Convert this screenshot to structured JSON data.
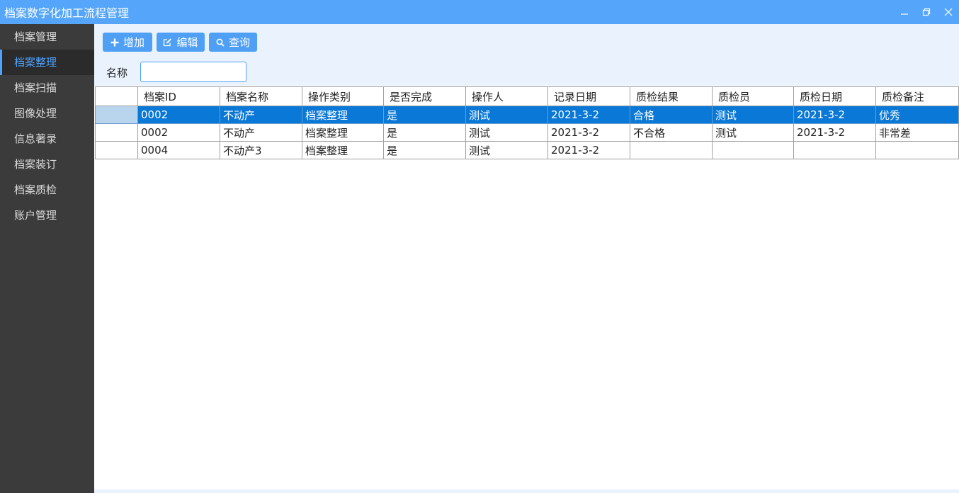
{
  "window": {
    "title": "档案数字化加工流程管理",
    "controls": [
      "minimize-icon",
      "restore-icon",
      "close-icon"
    ]
  },
  "sidebar": {
    "items": [
      {
        "label": "档案管理",
        "active": false
      },
      {
        "label": "档案整理",
        "active": true
      },
      {
        "label": "档案扫描",
        "active": false
      },
      {
        "label": "图像处理",
        "active": false
      },
      {
        "label": "信息著录",
        "active": false
      },
      {
        "label": "档案装订",
        "active": false
      },
      {
        "label": "档案质检",
        "active": false
      },
      {
        "label": "账户管理",
        "active": false
      }
    ]
  },
  "toolbar": {
    "add_label": "增加",
    "add_icon": "plus-icon",
    "edit_label": "编辑",
    "edit_icon": "edit-icon",
    "query_label": "查询",
    "query_icon": "search-icon"
  },
  "filter": {
    "name_label": "名称",
    "name_value": ""
  },
  "table": {
    "columns": [
      "档案ID",
      "档案名称",
      "操作类别",
      "是否完成",
      "操作人",
      "记录日期",
      "质检结果",
      "质检员",
      "质检日期",
      "质检备注"
    ],
    "rows": [
      {
        "selected": true,
        "cells": [
          "0002",
          "不动产",
          "档案整理",
          "是",
          "测试",
          "2021-3-2",
          "合格",
          "测试",
          "2021-3-2",
          "优秀"
        ]
      },
      {
        "selected": false,
        "cells": [
          "0002",
          "不动产",
          "档案整理",
          "是",
          "测试",
          "2021-3-2",
          "不合格",
          "测试",
          "2021-3-2",
          "非常差"
        ]
      },
      {
        "selected": false,
        "cells": [
          "0004",
          "不动产3",
          "档案整理",
          "是",
          "测试",
          "2021-3-2",
          "",
          "",
          "",
          ""
        ]
      }
    ]
  },
  "colors": {
    "titlebar": "#55a6fb",
    "sidebar_bg": "#3b3b3b",
    "sidebar_active_text": "#4ea3ff",
    "button_bg": "#4fa0f5",
    "selected_row": "#0a78d7",
    "toolbar_bg": "#eaf3fd"
  }
}
